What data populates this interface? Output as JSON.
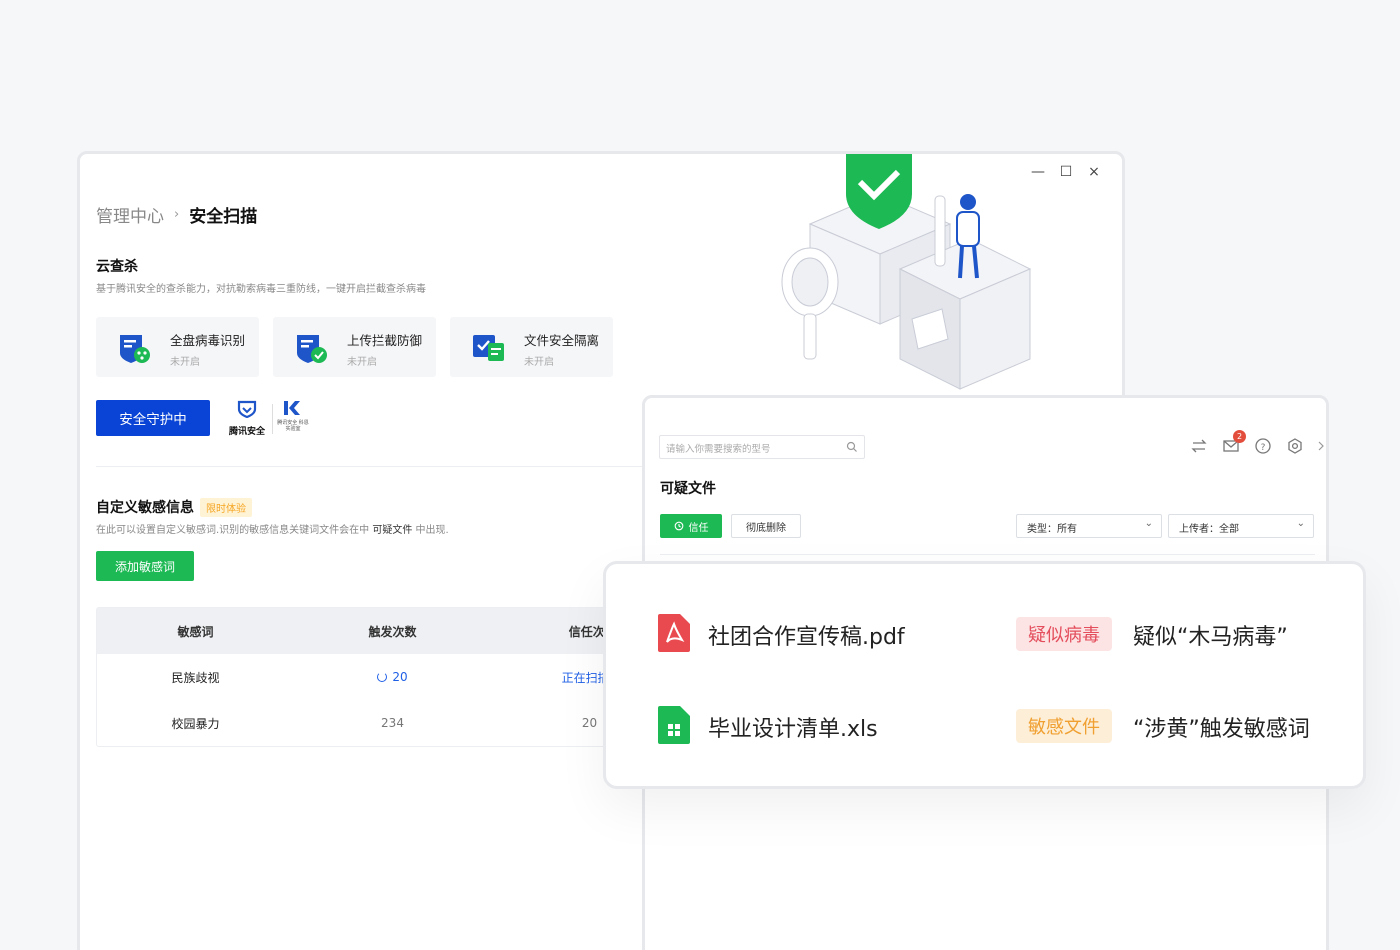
{
  "window_controls": {
    "minimize": "—",
    "maximize": "☐",
    "close": "×"
  },
  "breadcrumb": {
    "parent": "管理中心",
    "separator": "›",
    "current": "安全扫描"
  },
  "cloud_scan": {
    "title": "云查杀",
    "description": "基于腾讯安全的查杀能力，对抗勒索病毒三重防线，一键开启拦截查杀病毒",
    "features": [
      {
        "name": "全盘病毒识别",
        "status": "未开启"
      },
      {
        "name": "上传拦截防御",
        "status": "未开启"
      },
      {
        "name": "文件安全隔离",
        "status": "未开启"
      }
    ],
    "guard_button": "安全守护中",
    "logo_tencent": "腾讯安全",
    "logo_lab": "腾讯安全 科恩实验室"
  },
  "sensitive": {
    "title": "自定义敏感信息",
    "badge": "限时体验",
    "description_pre": "在此可以设置自定义敏感词.识别的敏感信息关键词文件会在中 ",
    "description_link": "可疑文件",
    "description_post": " 中出现.",
    "add_button": "添加敏感词",
    "table": {
      "headers": [
        "敏感词",
        "触发次数",
        "信任次!"
      ],
      "rows": [
        {
          "word": "民族歧视",
          "count": "20",
          "trust": "正在扫描.."
        },
        {
          "word": "校园暴力",
          "count": "234",
          "trust": "20"
        }
      ]
    }
  },
  "suspicious_window": {
    "search_placeholder": "请输入你需要搜索的型号",
    "mail_count": "2",
    "title": "可疑文件",
    "trust_button": "信任",
    "delete_button": "彻底删除",
    "filter_type": "类型：所有",
    "filter_uploader": "上传者：全部"
  },
  "file_card": {
    "files": [
      {
        "name": "社团合作宣传稿.pdf",
        "tag": "疑似病毒",
        "reason": "疑似“木马病毒”",
        "icon": "pdf-icon",
        "color": "#e84a50"
      },
      {
        "name": "毕业设计清单.xls",
        "tag": "敏感文件",
        "reason": "“涉黄”触发敏感词",
        "icon": "xls-icon",
        "color": "#1db954"
      }
    ]
  },
  "colors": {
    "primary_blue": "#0a44d6",
    "green": "#1db954",
    "red": "#e34d5c",
    "orange": "#f0a030"
  }
}
